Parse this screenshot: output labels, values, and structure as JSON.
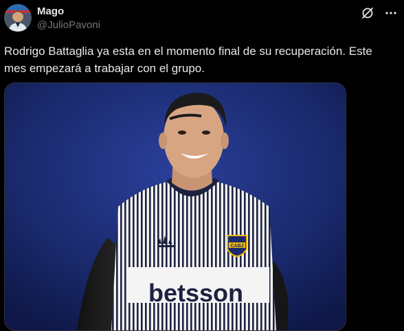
{
  "author": {
    "name": "Mago",
    "handle": "@JulioPavoni"
  },
  "tweet": {
    "text": "Rodrigo Battaglia ya esta en el momento final de su recuperación. Este mes empezará a trabajar con el grupo."
  },
  "media": {
    "sponsor_text": "betsson",
    "crest_text": "CABJ"
  },
  "icons": {
    "grok": "grok-icon",
    "more": "more-icon"
  },
  "colors": {
    "background": "#000000",
    "text": "#e7e9ea",
    "secondary": "#71767b",
    "photo_bg": "#1a2a6e",
    "crest_gold": "#f2b705"
  }
}
